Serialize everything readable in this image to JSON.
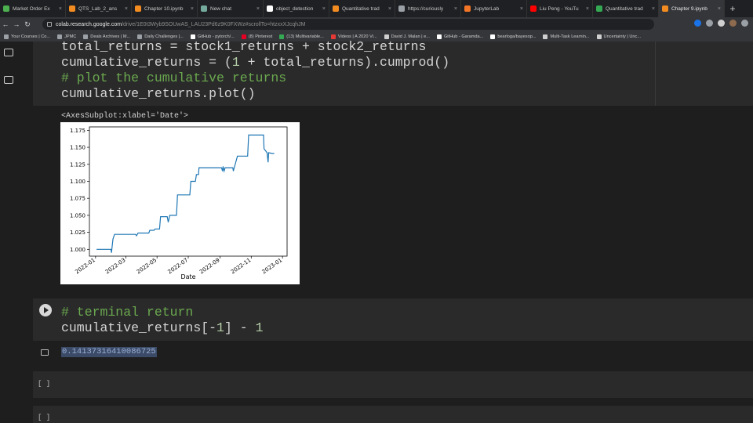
{
  "browser": {
    "tabs": [
      {
        "label": "Market Order Ex",
        "color": "#4caf50"
      },
      {
        "label": "QTS_Lab_2_ans",
        "color": "#f28b20"
      },
      {
        "label": "Chapter 10.ipynb",
        "color": "#f28b20"
      },
      {
        "label": "New chat",
        "color": "#74aa9c"
      },
      {
        "label": "object_detection",
        "color": "#ffffff"
      },
      {
        "label": "Quantitative trad",
        "color": "#f28b20"
      },
      {
        "label": "https://curiously",
        "color": "#9aa0a6"
      },
      {
        "label": "JupyterLab",
        "color": "#f37626"
      },
      {
        "label": "Liu Peng - YouTu",
        "color": "#ff0000"
      },
      {
        "label": "Quantitative trad",
        "color": "#34a853"
      },
      {
        "label": "Chapter 9.ipynb",
        "color": "#f28b20"
      }
    ],
    "active_tab": 10,
    "new_tab": "+",
    "url_host": "colab.research.google.com",
    "url_rest": "/drive/1E0t3Wyb9SOUwAS_LAU23Pd6z9K0FXWz#scrollTo=htzxxXJcqhJM",
    "bookmarks": [
      {
        "label": "Your Courses | Co...",
        "color": "#9aa0a6"
      },
      {
        "label": "JPMC",
        "color": "#9aa0a6"
      },
      {
        "label": "Deals Archives | M...",
        "color": "#9aa0a6"
      },
      {
        "label": "Daily Challenges |...",
        "color": "#9aa0a6"
      },
      {
        "label": "GitHub - pytorch/...",
        "color": "#ffffff"
      },
      {
        "label": "(8) Pinterest",
        "color": "#e60023"
      },
      {
        "label": "(13) Multivariable...",
        "color": "#34a853"
      },
      {
        "label": "Videos | A 2020 Vi...",
        "color": "#e53935"
      },
      {
        "label": "David J. Malan | e...",
        "color": "#cfcfcf"
      },
      {
        "label": "GitHub - Garamda...",
        "color": "#ffffff"
      },
      {
        "label": "bearloga/bayesop...",
        "color": "#ffffff"
      },
      {
        "label": "Multi-Task Learnin...",
        "color": "#cfcfcf"
      },
      {
        "label": "Uncertainty | Unc...",
        "color": "#cfcfcf"
      }
    ]
  },
  "notebook": {
    "cell1": {
      "line1": "total_returns = stock1_returns + stock2_returns",
      "line2_a": "cumulative_returns = (",
      "line2_num": "1",
      "line2_b": " + total_returns).cumprod()",
      "line3": "# plot the cumulative returns",
      "line4": "cumulative_returns.plot()"
    },
    "cell1_output_repr": "<AxesSubplot:xlabel='Date'>",
    "cell2": {
      "line1": "# terminal return",
      "line2_a": "cumulative_returns[-",
      "line2_num1": "1",
      "line2_b": "] - ",
      "line2_num2": "1"
    },
    "cell2_output": "0.14137316410086725",
    "empty_cell_label": "[ ]"
  },
  "chart_data": {
    "type": "line",
    "xlabel": "Date",
    "ylabel": "",
    "x_ticks": [
      "2022-01",
      "2022-03",
      "2022-05",
      "2022-07",
      "2022-09",
      "2022-11",
      "2023-01"
    ],
    "y_ticks": [
      "1.000",
      "1.025",
      "1.050",
      "1.075",
      "1.100",
      "1.125",
      "1.150",
      "1.175"
    ],
    "ylim": [
      0.99,
      1.18
    ],
    "line_color": "#1f77b4",
    "series": [
      {
        "x": [
          "2022-01-03",
          "2022-01-15",
          "2022-01-31",
          "2022-02-01",
          "2022-02-04",
          "2022-02-07",
          "2022-03-20",
          "2022-03-22",
          "2022-03-25",
          "2022-04-05",
          "2022-04-15",
          "2022-04-17",
          "2022-04-25",
          "2022-04-27",
          "2022-05-06",
          "2022-05-08",
          "2022-05-21",
          "2022-05-23",
          "2022-05-26",
          "2022-06-01",
          "2022-06-08",
          "2022-06-10",
          "2022-07-04",
          "2022-07-06",
          "2022-07-15",
          "2022-07-17",
          "2022-07-21",
          "2022-07-22",
          "2022-08-01",
          "2022-09-04",
          "2022-09-06",
          "2022-09-07",
          "2022-09-09",
          "2022-09-11",
          "2022-09-26",
          "2022-09-27",
          "2022-10-05",
          "2022-10-12",
          "2022-10-25",
          "2022-10-27",
          "2022-11-25",
          "2022-11-26",
          "2022-12-02",
          "2022-12-04",
          "2022-12-05",
          "2022-12-12",
          "2022-12-16"
        ],
        "values": [
          1.0,
          1.0,
          1.0,
          0.995,
          1.015,
          1.022,
          1.022,
          1.02,
          1.024,
          1.024,
          1.024,
          1.028,
          1.028,
          1.03,
          1.03,
          1.048,
          1.048,
          1.04,
          1.05,
          1.05,
          1.05,
          1.08,
          1.08,
          1.1,
          1.1,
          1.11,
          1.11,
          1.12,
          1.12,
          1.12,
          1.115,
          1.122,
          1.115,
          1.12,
          1.12,
          1.115,
          1.137,
          1.137,
          1.137,
          1.168,
          1.168,
          1.148,
          1.142,
          1.128,
          1.142,
          1.141,
          1.141
        ]
      }
    ]
  }
}
